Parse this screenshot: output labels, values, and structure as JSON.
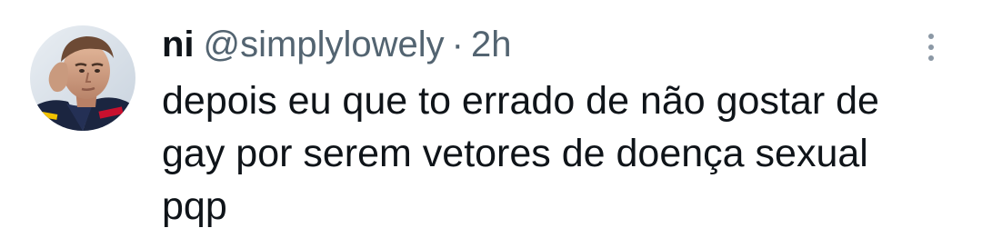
{
  "tweet": {
    "author_name": "ni",
    "handle": "@simplylowely",
    "separator": "·",
    "time": "2h",
    "text": "depois eu que to errado de não gostar de\ngay por serem vetores de doença sexual\npqp"
  },
  "icons": {
    "more": "more-vertical-dots-icon",
    "avatar": "user-avatar-photo"
  },
  "colors": {
    "text_primary": "#0f1419",
    "text_secondary": "#536471",
    "icon_gray": "#8b98a5",
    "background": "#ffffff"
  }
}
